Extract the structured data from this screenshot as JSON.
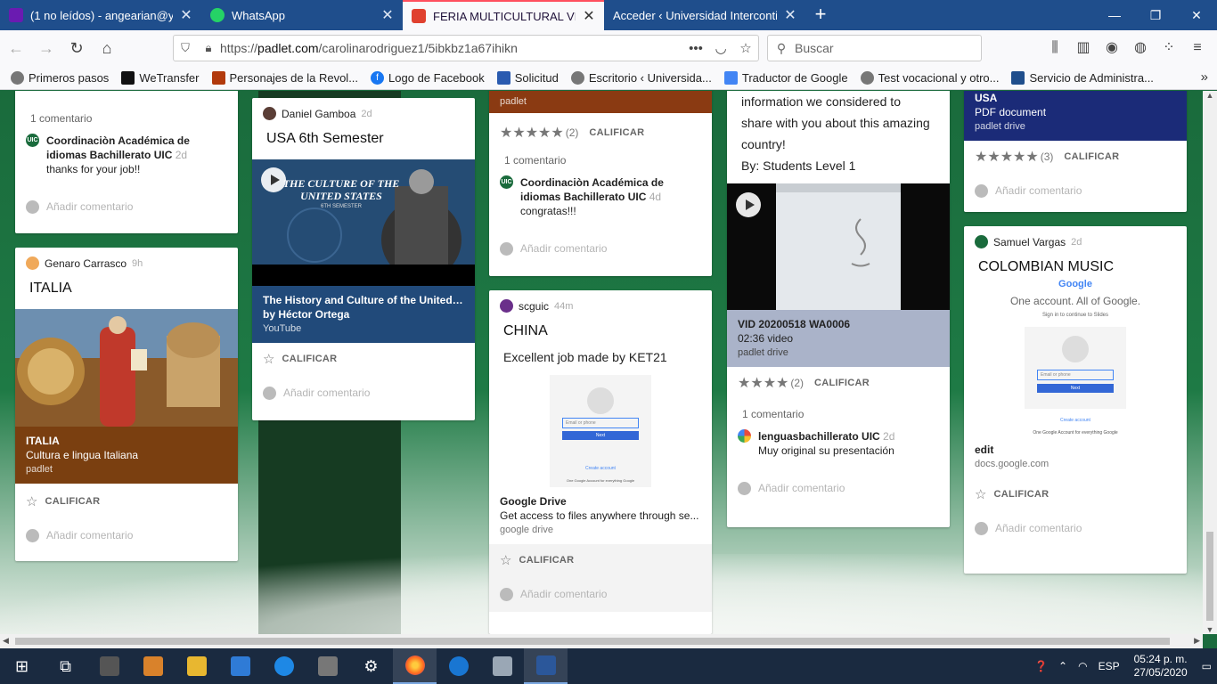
{
  "browser": {
    "tabs": [
      {
        "label": "(1 no leídos) - angearian@yahoo",
        "fav_color": "#6a1bb1",
        "active": false
      },
      {
        "label": "WhatsApp",
        "fav_color": "#25d366",
        "active": false
      },
      {
        "label": "FERIA MULTICULTURAL VIRTUAL",
        "fav_color": "#e0412f",
        "active": true
      },
      {
        "label": "Acceder ‹ Universidad Interconti",
        "fav_color": "#1f4e8c",
        "active": false
      }
    ],
    "url": {
      "scheme": "https://",
      "host": "padlet.com",
      "path": "/carolinarodriguez1/5ibkbz1a67ihikn"
    },
    "search_placeholder": "Buscar",
    "bookmarks": [
      {
        "label": "Primeros pasos",
        "color": "#666"
      },
      {
        "label": "WeTransfer",
        "color": "#111"
      },
      {
        "label": "Personajes de la Revol...",
        "color": "#b23a0c"
      },
      {
        "label": "Logo de Facebook",
        "color": "#1877f2"
      },
      {
        "label": "Solicitud",
        "color": "#2a5bb0"
      },
      {
        "label": "Escritorio ‹ Universida...",
        "color": "#666"
      },
      {
        "label": "Traductor de Google",
        "color": "#4285f4"
      },
      {
        "label": "Test vocacional y otro...",
        "color": "#666"
      },
      {
        "label": "Servicio de Administra...",
        "color": "#1f4e8c"
      }
    ]
  },
  "columns": {
    "col1": {
      "top_card": {
        "comments_count": "1 comentario",
        "comment": {
          "author": "Coordinaciòn Académica de idiomas Bachillerato UIC",
          "time": "2d",
          "text": "thanks for your job!!"
        },
        "add_comment": "Añadir comentario"
      },
      "italia_card": {
        "author": "Genaro Carrasco",
        "time": "9h",
        "title": "ITALIA",
        "attachment": {
          "title": "ITALIA",
          "subtitle": "Cultura e lingua Italiana",
          "source": "padlet"
        },
        "rate_label": "CALIFICAR",
        "add_comment": "Añadir comentario"
      }
    },
    "col2": {
      "usa_card": {
        "author": "Daniel Gamboa",
        "time": "2d",
        "title": "USA 6th Semester",
        "thumb_text": "THE CULTURE OF THE UNITED STATES",
        "thumb_sub": "6TH SEMESTER",
        "attachment": {
          "title": "The History and Culture of the United St...",
          "subtitle": "by Héctor Ortega",
          "source": "YouTube"
        },
        "rate_label": "CALIFICAR",
        "add_comment": "Añadir comentario"
      }
    },
    "col3": {
      "top_card": {
        "attachment_source": "padlet",
        "rating_count": "(2)",
        "rate_label": "CALIFICAR",
        "comments_count": "1 comentario",
        "comment": {
          "author": "Coordinaciòn Académica de idiomas Bachillerato UIC",
          "time": "4d",
          "text": "congratas!!!"
        },
        "add_comment": "Añadir comentario"
      },
      "china_card": {
        "author": "scguic",
        "time": "44m",
        "title": "CHINA",
        "body": "Excellent job made by KET21",
        "attachment": {
          "title": "Google Drive",
          "subtitle": "Get access to files anywhere through se...",
          "source": "google drive"
        },
        "rate_label": "CALIFICAR",
        "add_comment": "Añadir comentario"
      }
    },
    "col4": {
      "video_card": {
        "body_lines": [
          "information we considered to",
          "share with you about this amazing",
          "country!",
          "By: Students Level 1"
        ],
        "attachment": {
          "title": "VID 20200518 WA0006",
          "subtitle": "02:36 video",
          "source": "padlet drive"
        },
        "rating_count": "(2)",
        "rate_label": "CALIFICAR",
        "comments_count": "1 comentario",
        "comment": {
          "author": "lenguasbachillerato UIC",
          "time": "2d",
          "text": "Muy original su presentación"
        },
        "add_comment": "Añadir comentario"
      }
    },
    "col5": {
      "pdf_card": {
        "attachment": {
          "title": "USA",
          "subtitle": "PDF document",
          "source": "padlet drive"
        },
        "rating_count": "(3)",
        "rate_label": "CALIFICAR",
        "add_comment": "Añadir comentario"
      },
      "music_card": {
        "author": "Samuel Vargas",
        "time": "2d",
        "title": "COLOMBIAN MUSIC",
        "google_logo": "Google",
        "google_tagline": "One account. All of Google.",
        "google_signin": "Sign in to continue to Slides",
        "attachment": {
          "title": "edit",
          "source": "docs.google.com"
        },
        "rate_label": "CALIFICAR",
        "add_comment": "Añadir comentario"
      }
    }
  },
  "gdrive_thumb": {
    "field": "Email or phone",
    "button": "Next",
    "link": "Create account",
    "footer": "One Google Account for everything Google"
  },
  "taskbar": {
    "lang": "ESP",
    "time": "05:24 p. m.",
    "date": "27/05/2020"
  },
  "colors": {
    "italia_attach": "#7a3f10",
    "usa_attach": "#214a7a",
    "video_attach": "#aab3c9",
    "pdf_attach": "#1b2b78",
    "top_attach_col3": "#8a3a12",
    "accent_tab": "#ff4f5e"
  }
}
